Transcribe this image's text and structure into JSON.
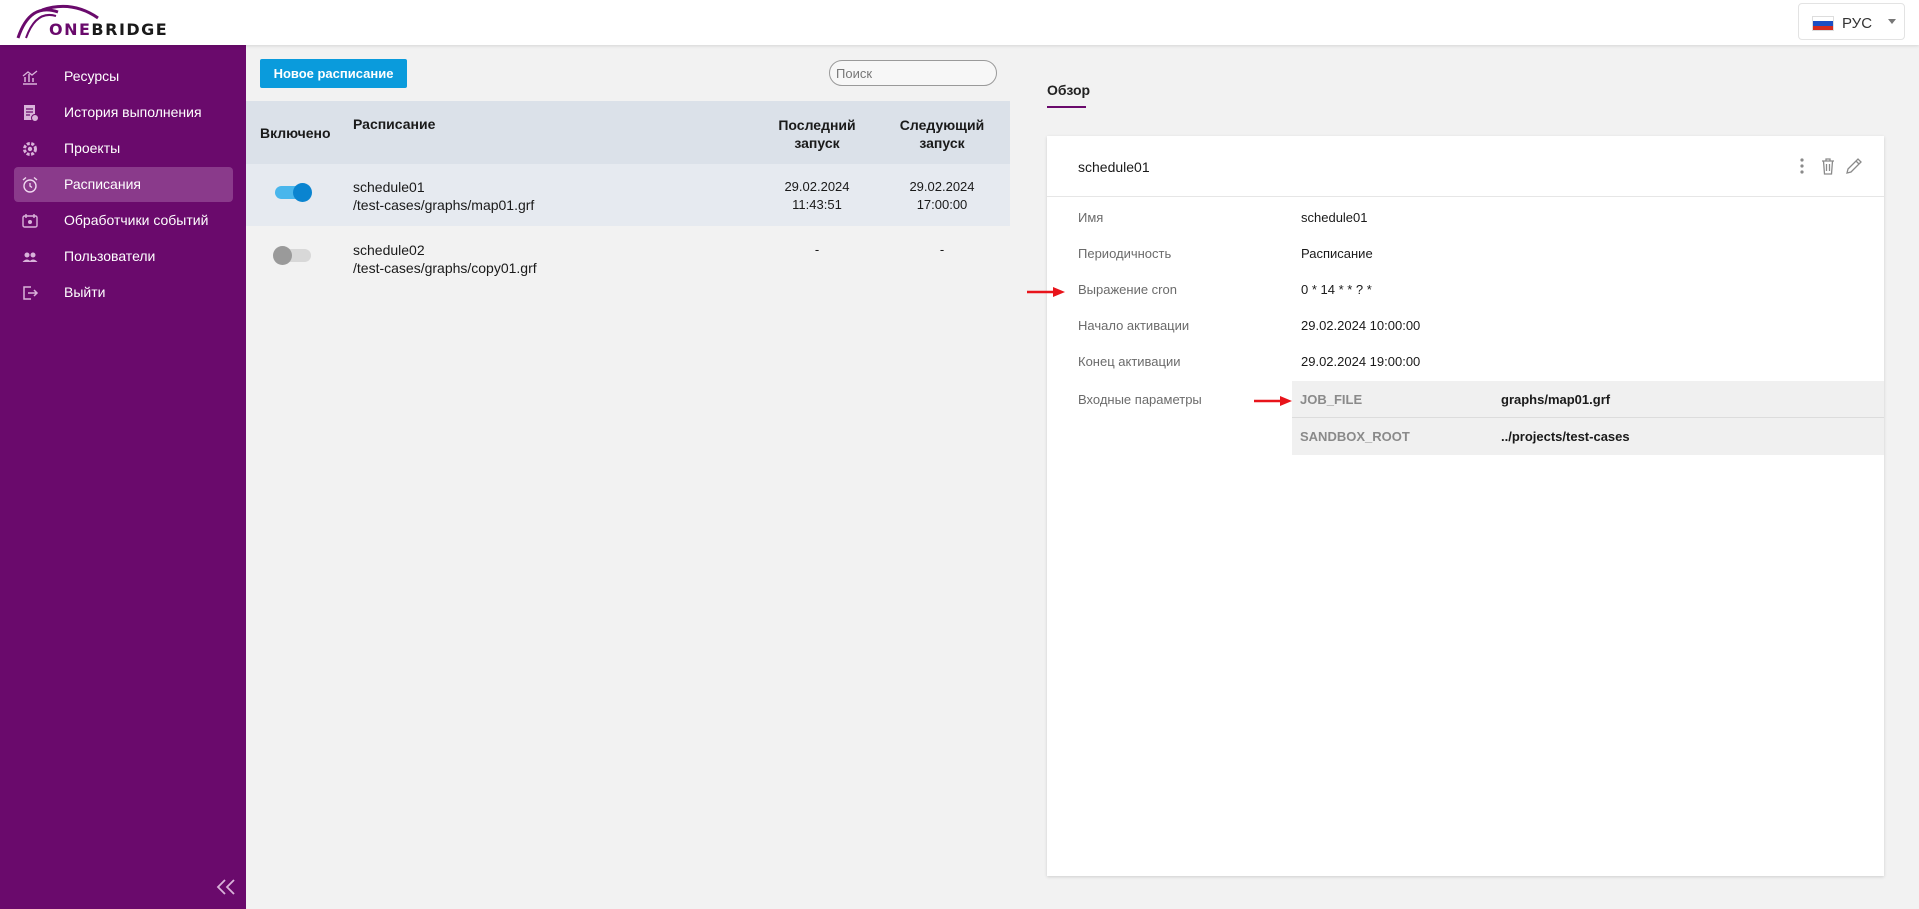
{
  "header": {
    "logo": {
      "prefix": "ONE",
      "suffix": "BRIDGE"
    },
    "language": {
      "label": "РУС",
      "flag_colors": [
        "#ffffff",
        "#1c4fc4",
        "#d52b1e"
      ]
    }
  },
  "sidebar": {
    "items": [
      {
        "label": "Ресурсы",
        "icon": "chart-icon",
        "active": false
      },
      {
        "label": "История выполнения",
        "icon": "history-icon",
        "active": false
      },
      {
        "label": "Проекты",
        "icon": "gear-icon",
        "active": false
      },
      {
        "label": "Расписания",
        "icon": "alarm-clock-icon",
        "active": true
      },
      {
        "label": "Обработчики событий",
        "icon": "event-icon",
        "active": false
      },
      {
        "label": "Пользователи",
        "icon": "users-icon",
        "active": false
      },
      {
        "label": "Выйти",
        "icon": "logout-icon",
        "active": false
      }
    ]
  },
  "schedules": {
    "new_button": "Новое расписание",
    "search": {
      "placeholder": "Поиск",
      "value": ""
    },
    "columns": {
      "enabled": "Включено",
      "schedule": "Расписание",
      "last_run": {
        "line1": "Последний",
        "line2": "запуск"
      },
      "next_run": {
        "line1": "Следующий",
        "line2": "запуск"
      }
    },
    "rows": [
      {
        "enabled": true,
        "name": "schedule01",
        "path": "/test-cases/graphs/map01.grf",
        "last_run": {
          "date": "29.02.2024",
          "time": "11:43:51"
        },
        "next_run": {
          "date": "29.02.2024",
          "time": "17:00:00"
        },
        "selected": true
      },
      {
        "enabled": false,
        "name": "schedule02",
        "path": "/test-cases/graphs/copy01.grf",
        "last_run": {
          "date": "-",
          "time": ""
        },
        "next_run": {
          "date": "-",
          "time": ""
        },
        "selected": false
      }
    ]
  },
  "detail": {
    "tab": "Обзор",
    "title": "schedule01",
    "fields": [
      {
        "label": "Имя",
        "value": "schedule01"
      },
      {
        "label": "Периодичность",
        "value": "Расписание"
      },
      {
        "label": "Выражение cron",
        "value": "0 * 14 * * ? *"
      },
      {
        "label": "Начало активации",
        "value": "29.02.2024 10:00:00"
      },
      {
        "label": "Конец активации",
        "value": "29.02.2024 19:00:00"
      }
    ],
    "params_label": "Входные параметры",
    "params": [
      {
        "key": "JOB_FILE",
        "value": "graphs/map01.grf"
      },
      {
        "key": "SANDBOX_ROOT",
        "value": "../projects/test-cases"
      }
    ]
  },
  "colors": {
    "brand": "#6a0a6c",
    "accent_blue": "#0a9bdc",
    "annotation_red": "#e8141b"
  }
}
